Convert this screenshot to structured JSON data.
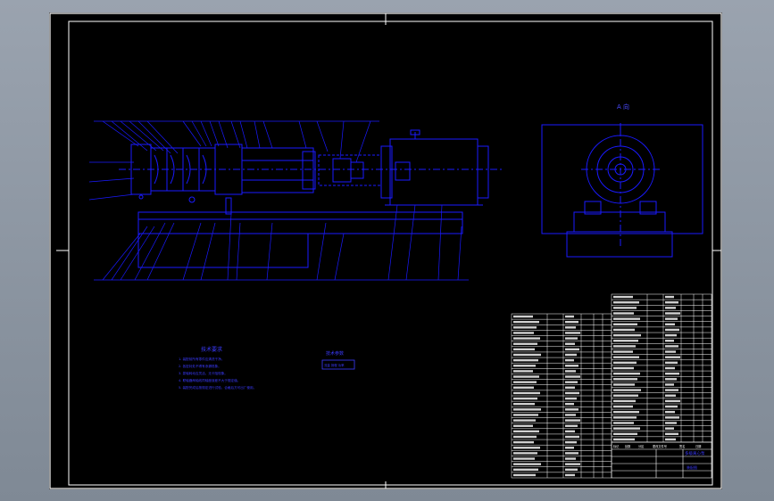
{
  "drawing": {
    "view_label": "A 向",
    "tech_requirements": {
      "title": "技术要求",
      "lines": [
        "1. 装配前所有零件应清洗干净。",
        "2. 各密封处不得有渗漏现象。",
        "3. 泵轴转动应灵活，无卡阻现象。",
        "4. 联轴器两轴线同轴度误差不大于规定值。",
        "5. 装配完成后按规定进行试验，合格后方可出厂使用。"
      ]
    },
    "spec_box": {
      "title": "技术参数",
      "text": "流量 扬程 功率"
    },
    "title_block": {
      "name": "多级离心泵",
      "drawing_no": "装配图",
      "scale_header": [
        "标记",
        "处数",
        "分区",
        "更改文件号",
        "签名",
        "日期"
      ]
    }
  },
  "colors": {
    "background": "#000000",
    "line": "#1a1aff",
    "frame": "#ffffff"
  }
}
